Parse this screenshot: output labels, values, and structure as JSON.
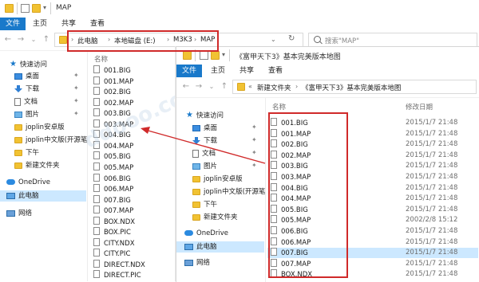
{
  "back_window": {
    "title": "MAP",
    "tabs": [
      "文件",
      "主页",
      "共享",
      "查看"
    ],
    "breadcrumb": [
      "此电脑",
      "本地磁盘 (E:)",
      "M3K3",
      "MAP"
    ],
    "search_placeholder": "搜索\"MAP\"",
    "column_name": "名称",
    "nav": [
      {
        "label": "快速访问",
        "icon": "star-icon"
      },
      {
        "label": "桌面",
        "icon": "desktop-icon"
      },
      {
        "label": "下载",
        "icon": "download-icon"
      },
      {
        "label": "文档",
        "icon": "documents-icon"
      },
      {
        "label": "图片",
        "icon": "pictures-icon"
      },
      {
        "label": "joplin安卓版",
        "icon": "folder-icon"
      },
      {
        "label": "joplin中文版(开源笔",
        "icon": "folder-icon"
      },
      {
        "label": "下午",
        "icon": "folder-icon"
      },
      {
        "label": "新建文件夹",
        "icon": "folder-icon"
      },
      {
        "label": "OneDrive",
        "icon": "onedrive-icon"
      },
      {
        "label": "此电脑",
        "icon": "this-pc-icon"
      },
      {
        "label": "网络",
        "icon": "network-icon"
      }
    ],
    "files": [
      "001.BIG",
      "001.MAP",
      "002.BIG",
      "002.MAP",
      "003.BIG",
      "003.MAP",
      "004.BIG",
      "004.MAP",
      "005.BIG",
      "005.MAP",
      "006.BIG",
      "006.MAP",
      "007.BIG",
      "007.MAP",
      "BOX.NDX",
      "BOX.PIC",
      "CITY.NDX",
      "CITY.PIC",
      "DIRECT.NDX",
      "DIRECT.PIC"
    ]
  },
  "front_window": {
    "title": "《富甲天下3》基本完美版本地图",
    "tabs": [
      "文件",
      "主页",
      "共享",
      "查看"
    ],
    "breadcrumb": [
      "新建文件夹",
      "《富甲天下3》基本完美版本地图"
    ],
    "column_name": "名称",
    "column_date": "修改日期",
    "nav": [
      {
        "label": "快速访问",
        "icon": "star-icon"
      },
      {
        "label": "桌面",
        "icon": "desktop-icon"
      },
      {
        "label": "下载",
        "icon": "download-icon"
      },
      {
        "label": "文档",
        "icon": "documents-icon"
      },
      {
        "label": "图片",
        "icon": "pictures-icon"
      },
      {
        "label": "joplin安卓版",
        "icon": "folder-icon"
      },
      {
        "label": "joplin中文版(开源笔",
        "icon": "folder-icon"
      },
      {
        "label": "下午",
        "icon": "folder-icon"
      },
      {
        "label": "新建文件夹",
        "icon": "folder-icon"
      },
      {
        "label": "OneDrive",
        "icon": "onedrive-icon"
      },
      {
        "label": "此电脑",
        "icon": "this-pc-icon"
      },
      {
        "label": "网络",
        "icon": "network-icon"
      }
    ],
    "files": [
      {
        "name": "001.BIG",
        "date": "2015/1/7 21:48"
      },
      {
        "name": "001.MAP",
        "date": "2015/1/7 21:48"
      },
      {
        "name": "002.BIG",
        "date": "2015/1/7 21:48"
      },
      {
        "name": "002.MAP",
        "date": "2015/1/7 21:48"
      },
      {
        "name": "003.BIG",
        "date": "2015/1/7 21:48"
      },
      {
        "name": "003.MAP",
        "date": "2015/1/7 21:48"
      },
      {
        "name": "004.BIG",
        "date": "2015/1/7 21:48"
      },
      {
        "name": "004.MAP",
        "date": "2015/1/7 21:48"
      },
      {
        "name": "005.BIG",
        "date": "2015/1/7 21:48"
      },
      {
        "name": "005.MAP",
        "date": "2002/2/8 15:12"
      },
      {
        "name": "006.BIG",
        "date": "2015/1/7 21:48"
      },
      {
        "name": "006.MAP",
        "date": "2015/1/7 21:48"
      },
      {
        "name": "007.BIG",
        "date": "2015/1/7 21:48"
      },
      {
        "name": "007.MAP",
        "date": "2015/1/7 21:48"
      },
      {
        "name": "BOX.NDX",
        "date": "2015/1/7 21:48"
      }
    ]
  },
  "colors": {
    "accent": "#1979ca",
    "highlight_box": "#d02a2a",
    "selected_row": "#cce8ff"
  }
}
